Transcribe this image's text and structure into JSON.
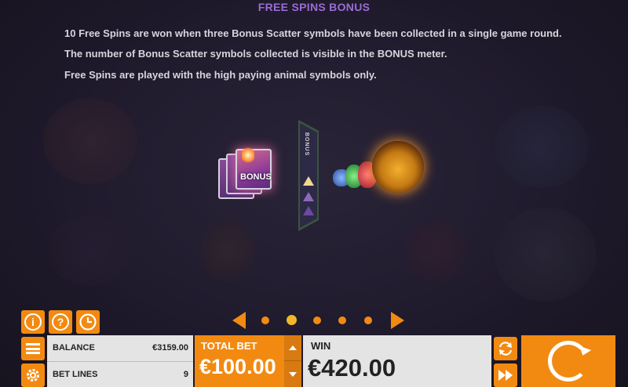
{
  "title": "FREE SPINS BONUS",
  "description": [
    "10 Free Spins are won when three Bonus Scatter symbols have been collected in a single game round.",
    "The number of Bonus Scatter symbols collected is visible in the BONUS meter.",
    "Free Spins are played with the high paying animal symbols only."
  ],
  "illustration": {
    "card_label": "BONUS",
    "meter_label": "BONUS"
  },
  "pagination": {
    "pages": 5,
    "active_index": 1
  },
  "balance": {
    "label": "BALANCE",
    "value": "€3159.00"
  },
  "bet_lines": {
    "label": "BET LINES",
    "value": "9"
  },
  "total_bet": {
    "label": "TOTAL BET",
    "value": "€100.00"
  },
  "win": {
    "label": "WIN",
    "value": "€420.00"
  },
  "icons": {
    "info": "info-icon",
    "help": "help-icon",
    "history": "clock-icon",
    "menu": "menu-icon",
    "settings": "gear-icon",
    "autoplay": "refresh-icon",
    "fast_play": "fast-forward-icon",
    "spin": "spin-icon"
  },
  "colors": {
    "accent": "#f28a12",
    "title": "#9b6cd6",
    "active_dot": "#f0b828"
  }
}
